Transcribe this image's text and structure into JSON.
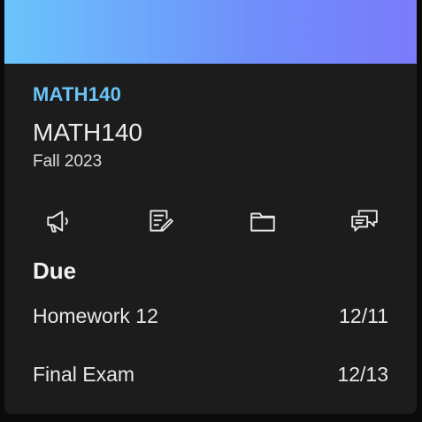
{
  "colors": {
    "accent": "#6ac4f5",
    "banner_start": "#6ac4fb",
    "banner_end": "#7a7bfa",
    "card_background": "#1c1c1c"
  },
  "course": {
    "code": "MATH140",
    "name": "MATH140",
    "term": "Fall 2023"
  },
  "actions": [
    {
      "icon": "megaphone-icon",
      "name": "announcements"
    },
    {
      "icon": "assignment-edit-icon",
      "name": "assignments"
    },
    {
      "icon": "folder-icon",
      "name": "files"
    },
    {
      "icon": "discussion-icon",
      "name": "discussions"
    }
  ],
  "due": {
    "heading": "Due",
    "items": [
      {
        "title": "Homework 12",
        "date": "12/11"
      },
      {
        "title": "Final Exam",
        "date": "12/13"
      }
    ]
  }
}
